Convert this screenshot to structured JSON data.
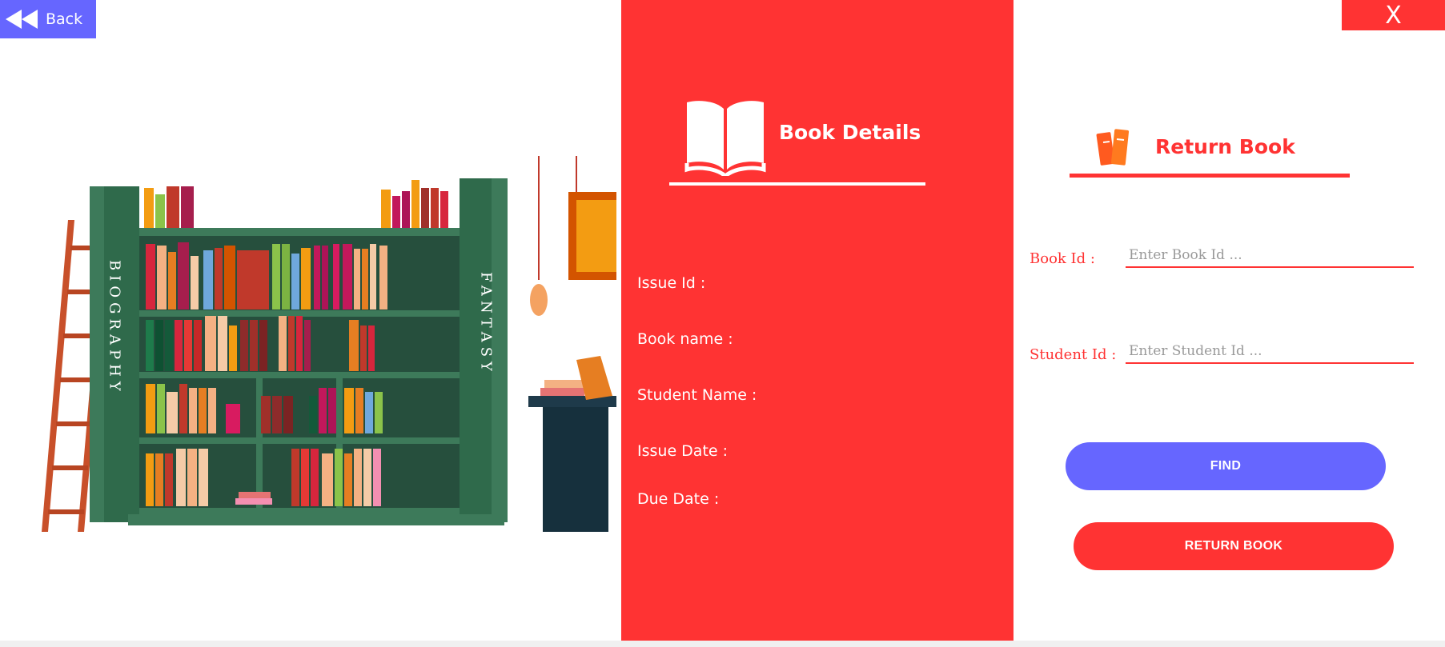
{
  "header": {
    "back_label": "Back",
    "close_label": "X"
  },
  "illustration": {
    "shelf_left_label": "BIOGRAPHY",
    "shelf_right_label": "FANTASY"
  },
  "details": {
    "title": "Book Details",
    "labels": {
      "issue_id": "Issue Id :",
      "book_name": "Book name :",
      "student_name": "Student Name :",
      "issue_date": "Issue Date :",
      "due_date": "Due Date :"
    }
  },
  "return_form": {
    "title": "Return Book",
    "book_id_label": "Book Id :",
    "book_id_placeholder": "Enter Book Id ...",
    "book_id_value": "",
    "student_id_label": "Student Id :",
    "student_id_placeholder": "Enter Student Id ...",
    "student_id_value": "",
    "find_label": "FIND",
    "return_label": "RETURN BOOK"
  },
  "colors": {
    "accent_red": "#ff3333",
    "accent_blue": "#6666ff",
    "shelf_green": "#3d7a5a"
  }
}
